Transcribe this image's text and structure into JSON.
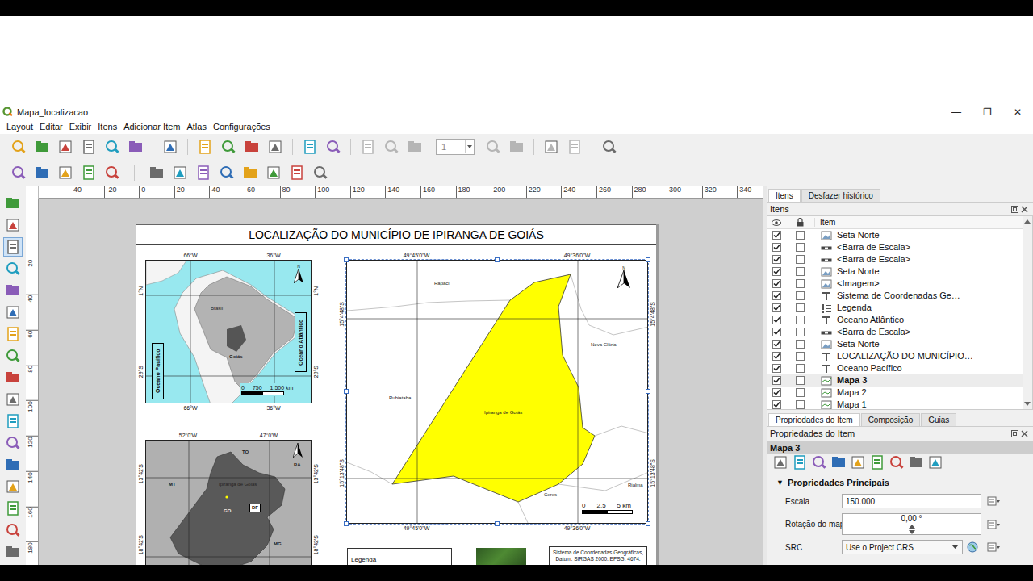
{
  "window": {
    "title": "Mapa_localizacao",
    "controls": [
      "—",
      "❐",
      "✕"
    ]
  },
  "menu": [
    "Layout",
    "Editar",
    "Exibir",
    "Itens",
    "Adicionar Item",
    "Atlas",
    "Configurações"
  ],
  "toolbar": {
    "page": "1"
  },
  "toolbox": [
    {
      "selected": false
    },
    {
      "selected": false
    },
    {
      "selected": true
    },
    {
      "selected": false
    },
    {
      "selected": false
    },
    {
      "selected": false
    },
    {
      "selected": false
    },
    {
      "selected": false
    },
    {
      "selected": false
    },
    {
      "selected": false
    },
    {
      "selected": false
    },
    {
      "selected": false
    },
    {
      "selected": false
    },
    {
      "selected": false
    },
    {
      "selected": false
    },
    {
      "selected": false
    },
    {
      "selected": false
    }
  ],
  "rulers": {
    "horizontal": [
      "-40",
      "-20",
      "0",
      "20",
      "40",
      "60",
      "80",
      "100",
      "120",
      "140",
      "160",
      "180",
      "200",
      "220",
      "240",
      "260",
      "280",
      "300",
      "320",
      "340"
    ],
    "vertical": [
      "20",
      "40",
      "60",
      "80",
      "100",
      "120",
      "140",
      "160",
      "180"
    ]
  },
  "layout": {
    "title": "LOCALIZAÇÃO DO MUNICÍPIO DE IPIRANGA DE GOIÁS",
    "overview_map": {
      "top_ticks": [
        "66°W",
        "36°W"
      ],
      "bottom_ticks": [
        "66°W",
        "36°W"
      ],
      "left_ticks": [
        "1°N",
        "29°S"
      ],
      "right_ticks": [
        "1°N",
        "29°S"
      ],
      "country": "Brasil",
      "state": "Goiás",
      "oceans": [
        "Oceano Pacífico",
        "Oceano Atlântico"
      ],
      "north": "N",
      "scale": [
        "0",
        "750",
        "1.500 km"
      ]
    },
    "state_map": {
      "top_ticks": [
        "52°0'W",
        "47°0'W"
      ],
      "left_ticks": [
        "13°42'S",
        "18°42'S"
      ],
      "right_ticks": [
        "13°42'S",
        "18°42'S"
      ],
      "labels": [
        "TO",
        "BA",
        "MT",
        "Ipiranga de Goiás",
        "GO",
        "MG"
      ],
      "boxed_label": "DF"
    },
    "municipality_map": {
      "top_ticks": [
        "49°45'0\"W",
        "49°36'0\"W"
      ],
      "bottom_ticks": [
        "49°45'0\"W",
        "49°36'0\"W"
      ],
      "left_ticks": [
        "15°4'48\"S",
        "15°13'48\"S"
      ],
      "right_ticks": [
        "15°4'48\"S",
        "15°13'48\"S"
      ],
      "places": [
        "Rapaci",
        "Rubiataba",
        "Nova Glória",
        "Ceres",
        "Rialma"
      ],
      "municipality": "Ipiranga de Goiás",
      "north": "N",
      "scale": [
        "0",
        "2,5",
        "5 km"
      ],
      "selected": true
    },
    "legend_title": "Legenda",
    "crs_note": [
      "Sistema de Coordenadas Geográficas,",
      "Datum: SIRGAS 2000. EPSG: 4674."
    ]
  },
  "items_panel": {
    "tabs": [
      {
        "label": "Itens",
        "selected": true
      },
      {
        "label": "Desfazer histórico",
        "selected": false
      }
    ],
    "title": "Itens",
    "column": "Item",
    "rows": [
      {
        "label": "Seta Norte",
        "visible": true,
        "locked": false,
        "selected": false,
        "kind": "picture"
      },
      {
        "label": "<Barra de Escala>",
        "visible": true,
        "locked": false,
        "selected": false,
        "kind": "scalebar"
      },
      {
        "label": "<Barra de Escala>",
        "visible": true,
        "locked": false,
        "selected": false,
        "kind": "scalebar"
      },
      {
        "label": "Seta Norte",
        "visible": true,
        "locked": false,
        "selected": false,
        "kind": "picture"
      },
      {
        "label": "<Imagem>",
        "visible": true,
        "locked": false,
        "selected": false,
        "kind": "picture"
      },
      {
        "label": "Sistema de Coordenadas Ge…",
        "visible": true,
        "locked": false,
        "selected": false,
        "kind": "label"
      },
      {
        "label": "Legenda",
        "visible": true,
        "locked": false,
        "selected": false,
        "kind": "legend"
      },
      {
        "label": "Oceano Atlântico",
        "visible": true,
        "locked": false,
        "selected": false,
        "kind": "label"
      },
      {
        "label": "<Barra de Escala>",
        "visible": true,
        "locked": false,
        "selected": false,
        "kind": "scalebar"
      },
      {
        "label": "Seta Norte",
        "visible": true,
        "locked": false,
        "selected": false,
        "kind": "picture"
      },
      {
        "label": "LOCALIZAÇÃO DO MUNICÍPIO…",
        "visible": true,
        "locked": false,
        "selected": false,
        "kind": "label"
      },
      {
        "label": "Oceano Pacífico",
        "visible": true,
        "locked": false,
        "selected": false,
        "kind": "label"
      },
      {
        "label": "Mapa 3",
        "visible": true,
        "locked": false,
        "selected": true,
        "kind": "map"
      },
      {
        "label": "Mapa 2",
        "visible": true,
        "locked": false,
        "selected": false,
        "kind": "map"
      },
      {
        "label": "Mapa 1",
        "visible": true,
        "locked": false,
        "selected": false,
        "kind": "map"
      }
    ]
  },
  "properties_panel": {
    "tabs": [
      {
        "label": "Propriedades do Item",
        "selected": true
      },
      {
        "label": "Composição",
        "selected": false
      },
      {
        "label": "Guias",
        "selected": false
      }
    ],
    "title": "Propriedades do Item",
    "item": "Mapa 3",
    "section": {
      "label": "Propriedades Principais",
      "toggle": "▼",
      "expanded": true
    },
    "fields": [
      {
        "label": "Escala",
        "value": "150.000",
        "kind": "text"
      },
      {
        "label": "Rotação do mapa",
        "value": "0,00 °",
        "kind": "spin"
      },
      {
        "label": "SRC",
        "value": "Use o Project CRS",
        "kind": "select"
      }
    ]
  }
}
